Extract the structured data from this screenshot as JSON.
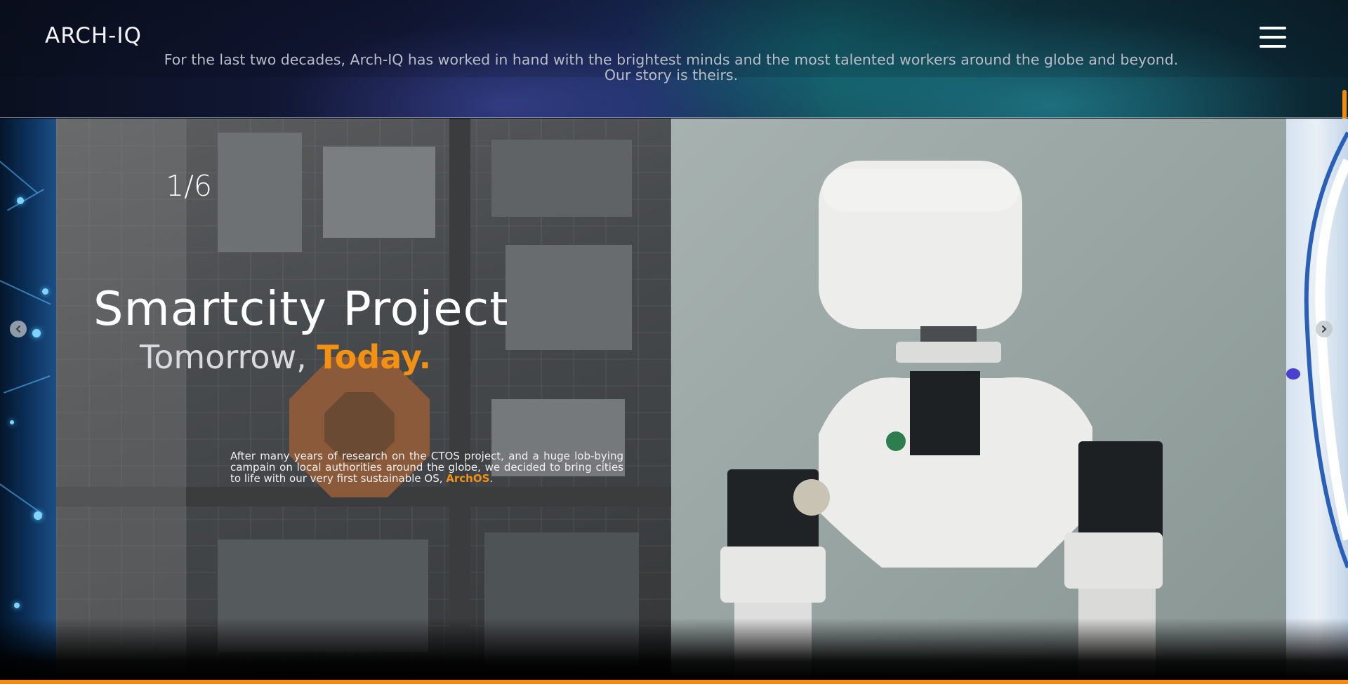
{
  "header": {
    "logo": "ARCH-IQ",
    "tagline": "For the last two decades, Arch-IQ has worked in hand with the brightest minds and the most talented workers around the globe and beyond. Our story is theirs.",
    "menu_icon": "hamburger-menu-icon"
  },
  "slider": {
    "counter": "1/6",
    "title": "Smartcity Project",
    "subtitle_plain": "Tomorrow, ",
    "subtitle_accent": "Today.",
    "body_text": "After many years of research on the CTOS project, and a huge lob-bying campain on local authorities around the globe, we decided to bring cities to life with our very first sustainable OS, ",
    "body_brand": "ArchOS",
    "body_end": ".",
    "prev_icon": "chevron-left-icon",
    "next_icon": "chevron-right-icon"
  },
  "colors": {
    "accent": "#f28c0f",
    "text": "#ffffff",
    "muted": "#b9bdc8"
  }
}
